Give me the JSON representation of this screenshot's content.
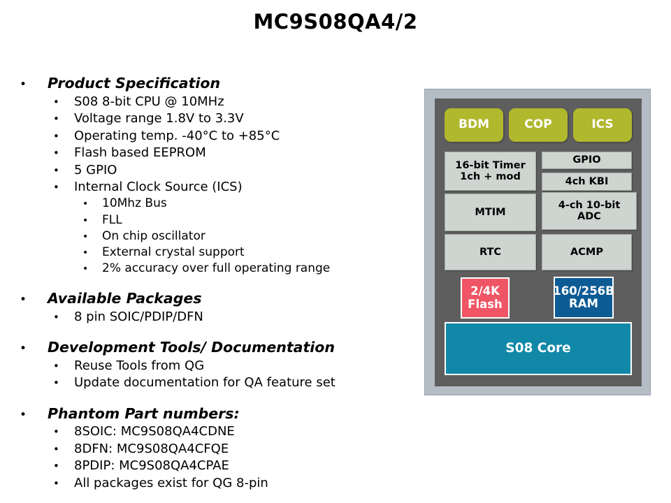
{
  "slide": {
    "title": "MC9S08QA4/2"
  },
  "bullet_char": "•",
  "content": {
    "sections": [
      {
        "heading": "Product Specification",
        "items": [
          {
            "text": "S08 8-bit CPU @ 10MHz",
            "sub": []
          },
          {
            "text": "Voltage range 1.8V to 3.3V",
            "sub": []
          },
          {
            "text": "Operating temp. -40°C to +85°C",
            "sub": []
          },
          {
            "text": "Flash based EEPROM",
            "sub": []
          },
          {
            "text": "5 GPIO",
            "sub": []
          },
          {
            "text": "Internal Clock Source (ICS)",
            "sub": [
              "10Mhz Bus",
              "FLL",
              "On chip oscillator",
              "External crystal support",
              "2% accuracy over full operating range"
            ]
          }
        ]
      },
      {
        "heading": "Available Packages",
        "items": [
          {
            "text": "8 pin SOIC/PDIP/DFN",
            "sub": []
          }
        ]
      },
      {
        "heading": "Development Tools/ Documentation",
        "items": [
          {
            "text": "Reuse Tools from QG",
            "sub": []
          },
          {
            "text": "Update documentation for QA feature set",
            "sub": []
          }
        ]
      },
      {
        "heading": "Phantom Part numbers:",
        "items": [
          {
            "text": "8SOIC: MC9S08QA4CDNE",
            "sub": []
          },
          {
            "text": "8DFN: MC9S08QA4CFQE",
            "sub": []
          },
          {
            "text": "8PDIP: MC9S08QA4CPAE",
            "sub": []
          },
          {
            "text": "All packages exist for QG 8-pin",
            "sub": []
          }
        ]
      }
    ]
  },
  "diagram": {
    "blocks": {
      "bdm": "BDM",
      "cop": "COP",
      "ics": "ICS",
      "timer": "16-bit Timer\n1ch + mod",
      "gpio": "GPIO",
      "kbi": "4ch KBI",
      "mtim": "MTIM",
      "adc": "4-ch 10-bit\nADC",
      "rtc": "RTC",
      "acmp": "ACMP",
      "flash": "2/4K\nFlash",
      "ram": "160/256B\nRAM",
      "core": "S08 Core"
    },
    "colors": {
      "olive": "#b0b82e",
      "light_gray": "#ced5d0",
      "flash_red": "#ef5564",
      "ram_blue": "#0d5b94",
      "core_teal": "#1188a8",
      "panel_dark_gray": "#5e5e5e",
      "frame_gray": "#b4bcc6"
    }
  }
}
